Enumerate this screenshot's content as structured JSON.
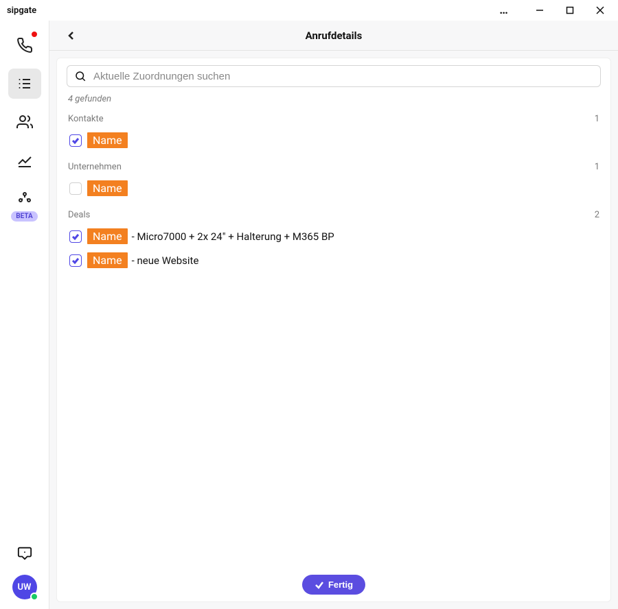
{
  "app_title": "sipgate",
  "sidebar": {
    "beta_label": "BETA",
    "avatar_initials": "UW"
  },
  "header": {
    "title": "Anrufdetails"
  },
  "search": {
    "placeholder": "Aktuelle Zuordnungen suchen"
  },
  "found_label": "4 gefunden",
  "sections": {
    "kontakte": {
      "title": "Kontakte",
      "count": "1",
      "items": [
        {
          "checked": true,
          "tag": "Name",
          "after": ""
        }
      ]
    },
    "unternehmen": {
      "title": "Unternehmen",
      "count": "1",
      "items": [
        {
          "checked": false,
          "tag": "Name",
          "after": ""
        }
      ]
    },
    "deals": {
      "title": "Deals",
      "count": "2",
      "items": [
        {
          "checked": true,
          "tag": "Name",
          "after": "- Micro7000 + 2x 24\" + Halterung + M365 BP"
        },
        {
          "checked": true,
          "tag": "Name",
          "after": "- neue Website"
        }
      ]
    }
  },
  "done_label": "Fertig"
}
